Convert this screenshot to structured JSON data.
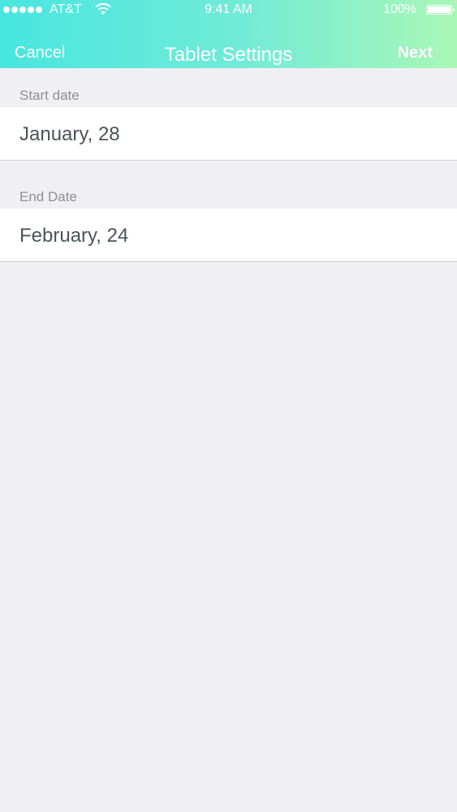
{
  "status_bar": {
    "carrier": "AT&T",
    "time": "9:41 AM",
    "battery_percent": "100%"
  },
  "nav": {
    "cancel_label": "Cancel",
    "title": "Tablet Settings",
    "next_label": "Next"
  },
  "form": {
    "start": {
      "label": "Start date",
      "value": "January, 28"
    },
    "end": {
      "label": "End Date",
      "value": "February, 24"
    }
  },
  "colors": {
    "gradient_start": "#48e6df",
    "gradient_end": "#a9f7b6",
    "background": "#efeff4",
    "value_text": "#4a5459",
    "label_text": "#8e8e93"
  }
}
